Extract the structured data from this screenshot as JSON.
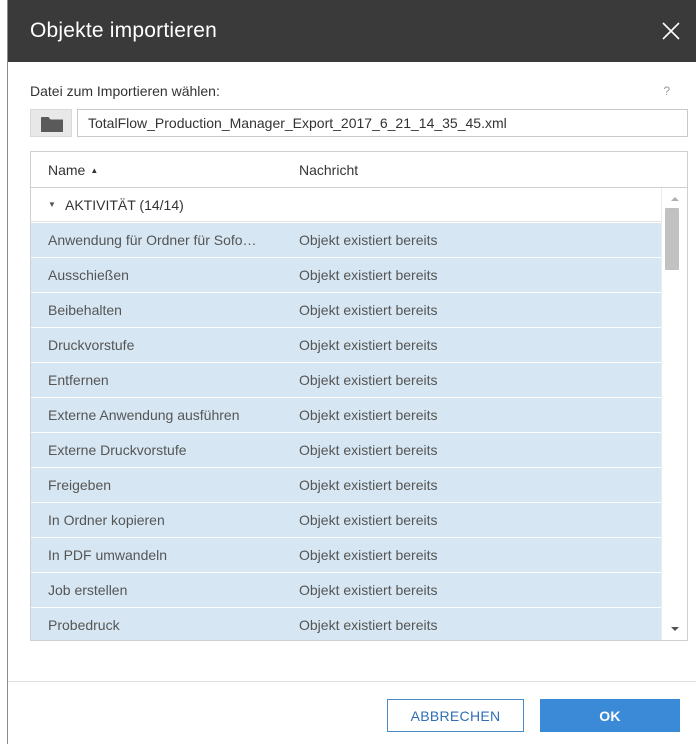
{
  "dialog": {
    "title": "Objekte importieren",
    "help": "?",
    "file_label": "Datei zum Importieren wählen:",
    "file_value": "TotalFlow_Production_Manager_Export_2017_6_21_14_35_45.xml"
  },
  "table": {
    "columns": [
      "Name",
      "Nachricht"
    ],
    "sort_indicator": "▲",
    "group_caret": "▼",
    "group_label": "AKTIVITÄT (14/14)",
    "rows": [
      {
        "name": "Anwendung für Ordner für Sofo…",
        "message": "Objekt existiert bereits"
      },
      {
        "name": "Ausschießen",
        "message": "Objekt existiert bereits"
      },
      {
        "name": "Beibehalten",
        "message": "Objekt existiert bereits"
      },
      {
        "name": "Druckvorstufe",
        "message": "Objekt existiert bereits"
      },
      {
        "name": "Entfernen",
        "message": "Objekt existiert bereits"
      },
      {
        "name": "Externe Anwendung ausführen",
        "message": "Objekt existiert bereits"
      },
      {
        "name": "Externe Druckvorstufe",
        "message": "Objekt existiert bereits"
      },
      {
        "name": "Freigeben",
        "message": "Objekt existiert bereits"
      },
      {
        "name": "In Ordner kopieren",
        "message": "Objekt existiert bereits"
      },
      {
        "name": "In PDF umwandeln",
        "message": "Objekt existiert bereits"
      },
      {
        "name": "Job erstellen",
        "message": "Objekt existiert bereits"
      },
      {
        "name": "Probedruck",
        "message": "Objekt existiert bereits"
      }
    ]
  },
  "buttons": {
    "cancel": "ABBRECHEN",
    "ok": "OK"
  },
  "icons": {
    "close": "close-icon",
    "folder": "folder-icon",
    "scroll_up": "scroll-up-arrow-icon",
    "scroll_down": "scroll-down-arrow-icon"
  },
  "colors": {
    "titlebar": "#3a3a3a",
    "selected_row": "#d6e7f3",
    "primary": "#3a8ad8"
  }
}
